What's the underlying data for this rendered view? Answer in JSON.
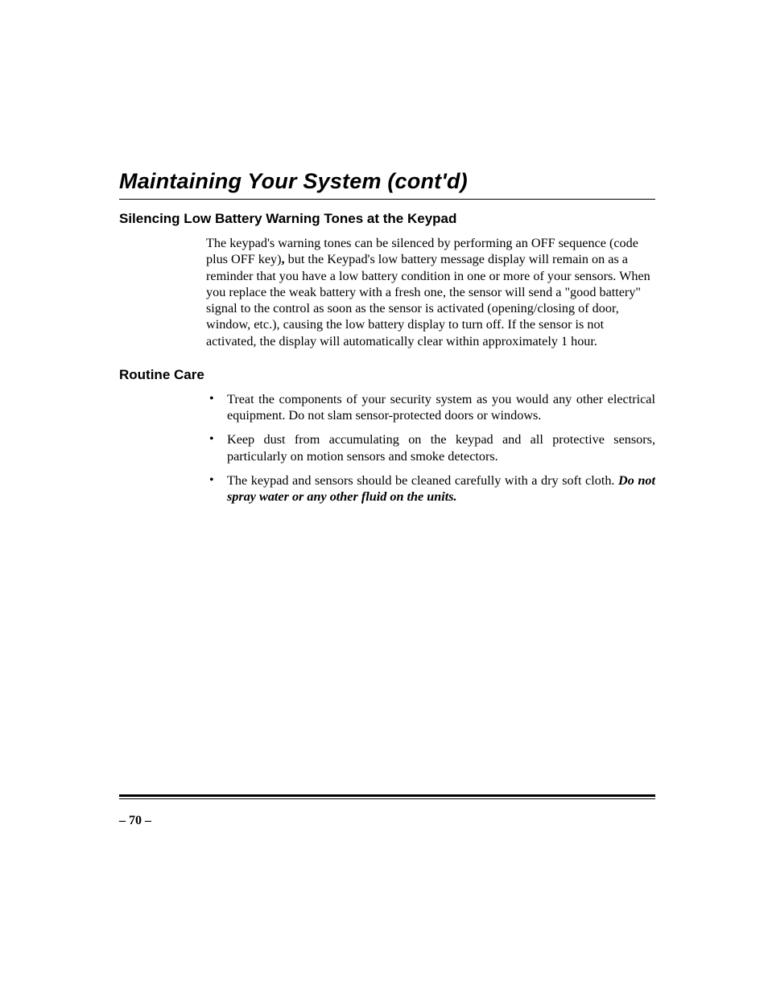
{
  "title": "Maintaining Your System (cont'd)",
  "sections": {
    "silencing": {
      "heading": "Silencing Low Battery Warning Tones at the Keypad",
      "para_pre": "The keypad's warning tones can be silenced by performing an OFF sequence (code plus OFF key)",
      "comma_bold": ",",
      "para_post": " but the Keypad's low battery message display will remain on as a reminder that you have a low battery condition in one or more of your sensors. When you replace the weak battery with a fresh one, the sensor will send a \"good battery\" signal to the control as soon as the sensor is activated (opening/closing of door, window, etc.), causing the low battery display to turn off. If the sensor is not activated, the display will automatically clear within approximately 1 hour."
    },
    "routine": {
      "heading": "Routine Care",
      "bullets": {
        "b1": "Treat the components of your security system as you would any other electrical equipment. Do not slam sensor-protected doors or windows.",
        "b2": "Keep dust from accumulating on the keypad and all protective sensors, particularly on motion sensors and smoke detectors.",
        "b3_pre": "The keypad and sensors should be cleaned carefully with a dry soft cloth. ",
        "b3_em": "Do not spray water or any other fluid on the units."
      }
    }
  },
  "page_number": "– 70 –"
}
